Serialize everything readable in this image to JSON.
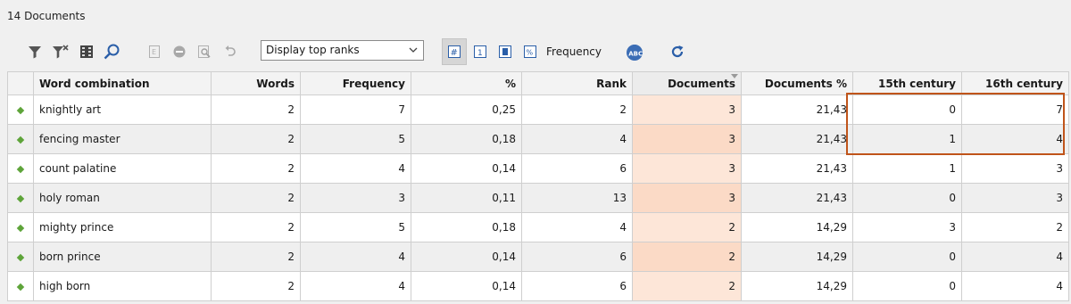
{
  "header": {
    "document_count": "14 Documents"
  },
  "toolbar": {
    "display_select": {
      "value": "Display top ranks"
    },
    "frequency_label": "Frequency",
    "icons": [
      "filter-icon",
      "clear-filter-icon",
      "columns-icon",
      "search-icon",
      "export-icon",
      "remove-icon",
      "zoom-icon",
      "undo-icon",
      "count-mode-icon",
      "rank-mode-icon",
      "document-mode-icon",
      "percent-mode-icon",
      "spellcheck-icon",
      "refresh-icon"
    ],
    "colors": {
      "accent": "#2a5ea8",
      "highlight": "#c0541a",
      "docs_bg": "#fde6d8",
      "marker": "#5ea43a"
    }
  },
  "table": {
    "headers": {
      "word": "Word combination",
      "words": "Words",
      "frequency": "Frequency",
      "percent": "%",
      "rank": "Rank",
      "documents": "Documents",
      "documents_pct": "Documents %",
      "c15": "15th century",
      "c16": "16th century"
    },
    "rows": [
      {
        "word": "knightly art",
        "words": "2",
        "frequency": "7",
        "percent": "0,25",
        "rank": "2",
        "documents": "3",
        "documents_pct": "21,43",
        "c15": "0",
        "c16": "7"
      },
      {
        "word": "fencing master",
        "words": "2",
        "frequency": "5",
        "percent": "0,18",
        "rank": "4",
        "documents": "3",
        "documents_pct": "21,43",
        "c15": "1",
        "c16": "4"
      },
      {
        "word": "count palatine",
        "words": "2",
        "frequency": "4",
        "percent": "0,14",
        "rank": "6",
        "documents": "3",
        "documents_pct": "21,43",
        "c15": "1",
        "c16": "3"
      },
      {
        "word": "holy roman",
        "words": "2",
        "frequency": "3",
        "percent": "0,11",
        "rank": "13",
        "documents": "3",
        "documents_pct": "21,43",
        "c15": "0",
        "c16": "3"
      },
      {
        "word": "mighty prince",
        "words": "2",
        "frequency": "5",
        "percent": "0,18",
        "rank": "4",
        "documents": "2",
        "documents_pct": "14,29",
        "c15": "3",
        "c16": "2"
      },
      {
        "word": "born prince",
        "words": "2",
        "frequency": "4",
        "percent": "0,14",
        "rank": "6",
        "documents": "2",
        "documents_pct": "14,29",
        "c15": "0",
        "c16": "4"
      },
      {
        "word": "high born",
        "words": "2",
        "frequency": "4",
        "percent": "0,14",
        "rank": "6",
        "documents": "2",
        "documents_pct": "14,29",
        "c15": "0",
        "c16": "4"
      }
    ]
  }
}
